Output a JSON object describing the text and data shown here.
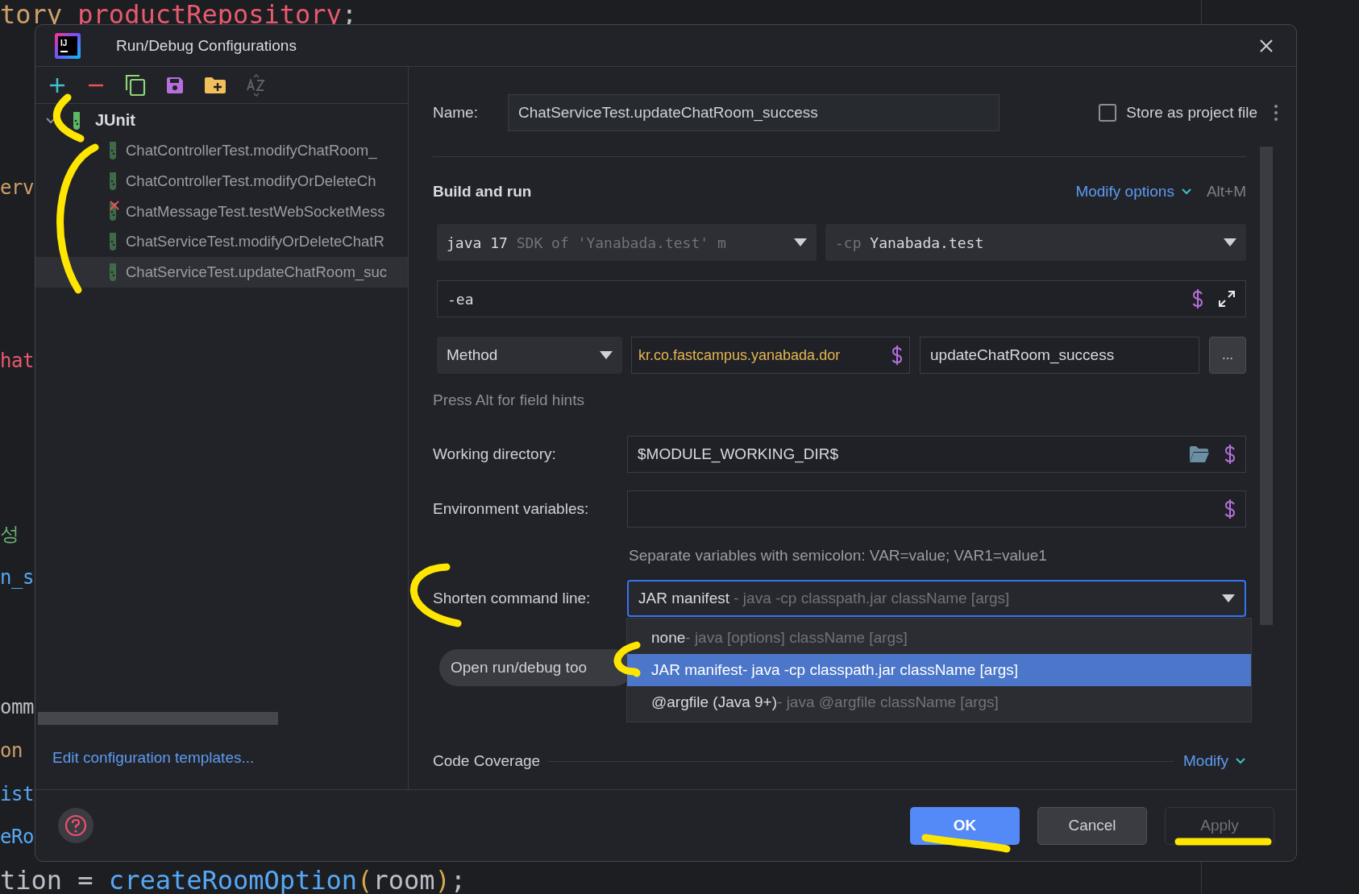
{
  "editor": {
    "lines": [
      {
        "tokens": [
          {
            "text": "tory ",
            "color": "#cf9f6a"
          },
          {
            "text": "productRepository",
            "color": "#e85a6e"
          },
          {
            "text": ";",
            "color": "#bcbec4"
          }
        ]
      },
      {
        "tokens": [
          {
            "text": "erv",
            "color": "#cf9f6a"
          }
        ]
      },
      {
        "tokens": [
          {
            "text": "hat",
            "color": "#e85a6e"
          }
        ]
      },
      {
        "tokens": [
          {
            "text": "성",
            "color": "#6aab73"
          }
        ]
      },
      {
        "tokens": [
          {
            "text": "n_s",
            "color": "#56a8f5"
          }
        ]
      },
      {
        "tokens": [
          {
            "text": "omm",
            "color": "#bcbec4"
          }
        ]
      },
      {
        "tokens": [
          {
            "text": "on",
            "color": "#cf9f6a"
          }
        ]
      },
      {
        "tokens": [
          {
            "text": "ist",
            "color": "#56a8f5"
          }
        ]
      },
      {
        "tokens": [
          {
            "text": "eRo",
            "color": "#56a8f5"
          }
        ]
      },
      {
        "tokens": [
          {
            "text": "tion = ",
            "color": "#bcbec4"
          },
          {
            "text": "createRoomOption",
            "color": "#56a8f5"
          },
          {
            "text": "(",
            "color": "#d5a84a"
          },
          {
            "text": "room",
            "color": "#bcbec4"
          },
          {
            "text": ")",
            "color": "#d5a84a"
          },
          {
            "text": ";",
            "color": "#bcbec4"
          }
        ]
      }
    ]
  },
  "dialog": {
    "logo_text": "IJ",
    "title": "Run/Debug Configurations",
    "toolbar": [
      {
        "kind": "add",
        "disabled": false
      },
      {
        "kind": "remove",
        "disabled": false
      },
      {
        "kind": "copy",
        "disabled": false
      },
      {
        "kind": "save",
        "disabled": false
      },
      {
        "kind": "folder",
        "disabled": false
      },
      {
        "kind": "sort",
        "disabled": true
      }
    ],
    "tree": {
      "label": "JUnit",
      "expanded": true,
      "children": [
        {
          "label": "ChatControllerTest.modifyChatRoom_",
          "selected": false,
          "failed": false
        },
        {
          "label": "ChatControllerTest.modifyOrDeleteCh",
          "selected": false,
          "failed": false
        },
        {
          "label": "ChatMessageTest.testWebSocketMess",
          "selected": false,
          "failed": true
        },
        {
          "label": "ChatServiceTest.modifyOrDeleteChatR",
          "selected": false,
          "failed": false
        },
        {
          "label": "ChatServiceTest.updateChatRoom_suc",
          "selected": true,
          "failed": false
        }
      ]
    },
    "edit_templates_link": "Edit configuration templates...",
    "name": {
      "label": "Name:",
      "value": "ChatServiceTest.updateChatRoom_success"
    },
    "store_as_project_file": {
      "label": "Store as project file",
      "checked": false
    },
    "build_and_run": {
      "title": "Build and run",
      "modify_options": "Modify options",
      "shortcut": "Alt+M",
      "jre": {
        "value": "java 17",
        "hint": "SDK of 'Yanabada.test' m"
      },
      "classpath": {
        "prefix": "-cp",
        "value": "Yanabada.test"
      },
      "vm_options": "-ea",
      "test_kind": "Method",
      "class": "kr.co.fastcampus.yanabada.dor",
      "method": "updateChatRoom_success",
      "browse": "...",
      "hint": "Press Alt for field hints"
    },
    "working_directory": {
      "label": "Working directory:",
      "value": "$MODULE_WORKING_DIR$"
    },
    "environment_variables": {
      "label": "Environment variables:",
      "hint": "Separate variables with semicolon: VAR=value; VAR1=value1"
    },
    "shorten_command_line": {
      "label": "Shorten command line:",
      "value": "JAR manifest",
      "hint": "- java -cp classpath.jar className [args]",
      "options": [
        {
          "label": "none",
          "hint": "- java [options] className [args]",
          "selected": false
        },
        {
          "label": "JAR manifest",
          "hint": "- java -cp classpath.jar className [args]",
          "selected": true
        },
        {
          "label": "@argfile (Java 9+)",
          "hint": "- java @argfile className [args]",
          "selected": false
        }
      ]
    },
    "open_tool_window": "Open run/debug too",
    "code_coverage": {
      "title": "Code Coverage",
      "modify": "Modify"
    },
    "buttons": [
      {
        "label": "OK",
        "kind": "primary"
      },
      {
        "label": "Cancel",
        "kind": "normal"
      },
      {
        "label": "Apply",
        "kind": "disabled"
      }
    ]
  }
}
